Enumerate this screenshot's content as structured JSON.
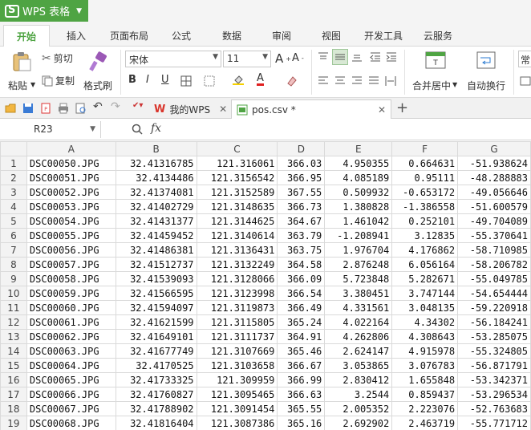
{
  "app": {
    "title": "WPS 表格"
  },
  "menu": {
    "tabs": [
      "开始",
      "插入",
      "页面布局",
      "公式",
      "数据",
      "审阅",
      "视图",
      "开发工具",
      "云服务"
    ]
  },
  "ribbon": {
    "paste": "粘贴",
    "cut": "剪切",
    "copy": "复制",
    "format_painter": "格式刷",
    "font_name": "宋体",
    "font_size": "11",
    "bold": "B",
    "italic": "I",
    "underline": "U",
    "merge_center": "合并居中",
    "wrap_text": "自动换行",
    "overflow_label": "常"
  },
  "doc_tabs": [
    {
      "label": "我的WPS"
    },
    {
      "label": "pos.csv *"
    }
  ],
  "formula": {
    "cell_ref": "R23",
    "fx": "fx"
  },
  "sheet": {
    "columns": [
      "A",
      "B",
      "C",
      "D",
      "E",
      "F",
      "G"
    ],
    "rows": [
      [
        "1",
        "DSC00050.JPG",
        "32.41316785",
        "121.316061",
        "366.03",
        "4.950355",
        "0.664631",
        "-51.938624"
      ],
      [
        "2",
        "DSC00051.JPG",
        "32.4134486",
        "121.3156542",
        "366.95",
        "4.085189",
        "0.95111",
        "-48.288883"
      ],
      [
        "3",
        "DSC00052.JPG",
        "32.41374081",
        "121.3152589",
        "367.55",
        "0.509932",
        "-0.653172",
        "-49.056646"
      ],
      [
        "4",
        "DSC00053.JPG",
        "32.41402729",
        "121.3148635",
        "366.73",
        "1.380828",
        "-1.386558",
        "-51.600579"
      ],
      [
        "5",
        "DSC00054.JPG",
        "32.41431377",
        "121.3144625",
        "364.67",
        "1.461042",
        "0.252101",
        "-49.704089"
      ],
      [
        "6",
        "DSC00055.JPG",
        "32.41459452",
        "121.3140614",
        "363.79",
        "-1.208941",
        "3.12835",
        "-55.370641"
      ],
      [
        "7",
        "DSC00056.JPG",
        "32.41486381",
        "121.3136431",
        "363.75",
        "1.976704",
        "4.176862",
        "-58.710985"
      ],
      [
        "8",
        "DSC00057.JPG",
        "32.41512737",
        "121.3132249",
        "364.58",
        "2.876248",
        "6.056164",
        "-58.206782"
      ],
      [
        "9",
        "DSC00058.JPG",
        "32.41539093",
        "121.3128066",
        "366.09",
        "5.723848",
        "5.282671",
        "-55.049785"
      ],
      [
        "10",
        "DSC00059.JPG",
        "32.41566595",
        "121.3123998",
        "366.54",
        "3.380451",
        "3.747144",
        "-54.654444"
      ],
      [
        "11",
        "DSC00060.JPG",
        "32.41594097",
        "121.3119873",
        "366.49",
        "4.331561",
        "3.048135",
        "-59.220918"
      ],
      [
        "12",
        "DSC00061.JPG",
        "32.41621599",
        "121.3115805",
        "365.24",
        "4.022164",
        "4.34302",
        "-56.184241"
      ],
      [
        "13",
        "DSC00062.JPG",
        "32.41649101",
        "121.3111737",
        "364.91",
        "4.262806",
        "4.308643",
        "-53.285075"
      ],
      [
        "14",
        "DSC00063.JPG",
        "32.41677749",
        "121.3107669",
        "365.46",
        "2.624147",
        "4.915978",
        "-55.324805"
      ],
      [
        "15",
        "DSC00064.JPG",
        "32.4170525",
        "121.3103658",
        "366.67",
        "3.053865",
        "3.076783",
        "-56.871791"
      ],
      [
        "16",
        "DSC00065.JPG",
        "32.41733325",
        "121.309959",
        "366.99",
        "2.830412",
        "1.655848",
        "-53.342371"
      ],
      [
        "17",
        "DSC00066.JPG",
        "32.41760827",
        "121.3095465",
        "366.63",
        "3.2544",
        "0.859437",
        "-53.296534"
      ],
      [
        "18",
        "DSC00067.JPG",
        "32.41788902",
        "121.3091454",
        "365.55",
        "2.005352",
        "2.223076",
        "-52.763683"
      ],
      [
        "19",
        "DSC00068.JPG",
        "32.41816404",
        "121.3087386",
        "365.16",
        "2.692902",
        "2.463719",
        "-55.771712"
      ]
    ]
  },
  "colors": {
    "accent": "#4fa443",
    "header_bg": "#f3f3f3"
  }
}
